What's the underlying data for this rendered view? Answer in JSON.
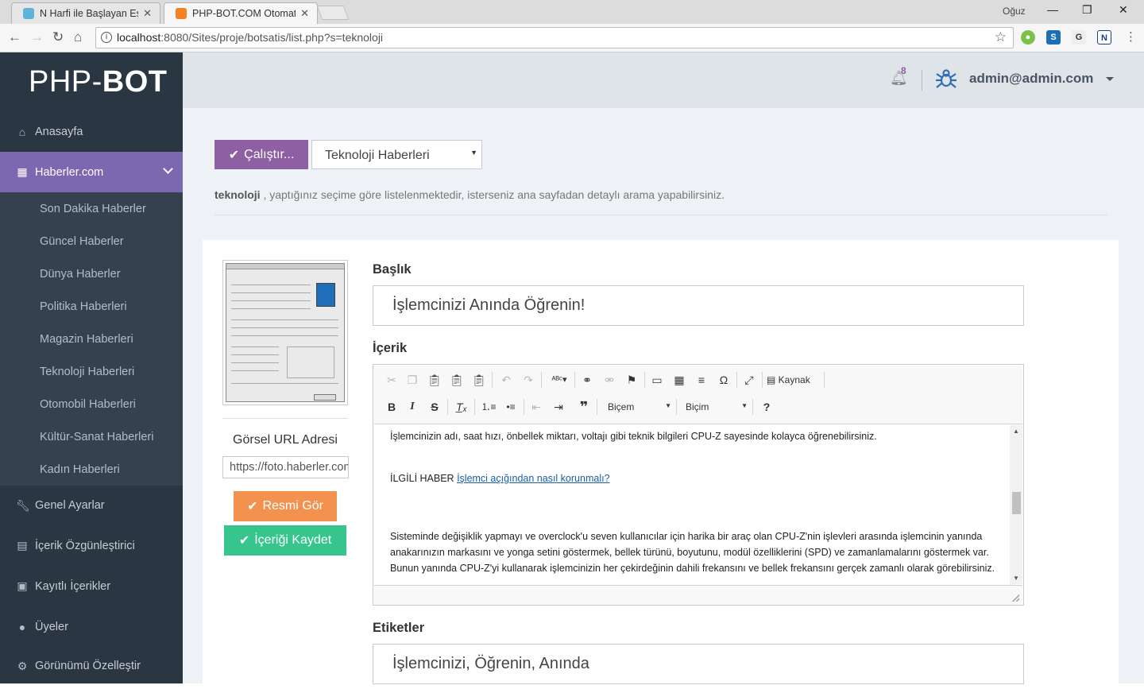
{
  "browser": {
    "tabs": [
      {
        "title": "N Harfi ile Başlayan Eş Ar",
        "active": false
      },
      {
        "title": "PHP-BOT.COM Otomatik",
        "active": true
      }
    ],
    "profile": "Oğuz",
    "url_host": "localhost",
    "url_rest": ":8080/Sites/proje/botsatis/list.php?s=teknoloji"
  },
  "sidebar": {
    "logo_light": "PHP-",
    "logo_bold": "BOT",
    "items": [
      {
        "label": "Anasayfa",
        "icon": "home-icon"
      },
      {
        "label": "Haberler.com",
        "icon": "grid-icon",
        "active": true
      },
      {
        "label": "Genel Ayarlar",
        "icon": "wrench-icon"
      },
      {
        "label": "İçerik Özgünleştirici",
        "icon": "file-icon"
      },
      {
        "label": "Kayıtlı İçerikler",
        "icon": "save-icon"
      },
      {
        "label": "Üyeler",
        "icon": "user-icon"
      },
      {
        "label": "Görünümü Özelleştir",
        "icon": "gear-icon"
      }
    ],
    "subitems": [
      "Son Dakika Haberler",
      "Güncel Haberler",
      "Dünya Haberler",
      "Politika Haberleri",
      "Magazin Haberleri",
      "Teknoloji Haberleri",
      "Otomobil Haberleri",
      "Kültür-Sanat Haberleri",
      "Kadın Haberleri"
    ]
  },
  "header": {
    "notification_count": "8",
    "user": "admin@admin.com"
  },
  "toolbar": {
    "run_label": "Çalıştır...",
    "category_selected": "Teknoloji Haberleri"
  },
  "info": {
    "keyword": "teknoloji",
    "text": " , yaptığınız seçime göre listelenmektedir, isterseniz ana sayfadan detaylı arama yapabilirsiniz."
  },
  "image_panel": {
    "url_label": "Görsel URL Adresi",
    "url_value": "https://foto.haberler.com",
    "show_image_label": "Resmi Gör",
    "save_label": "İçeriği Kaydet"
  },
  "form": {
    "title_label": "Başlık",
    "title_value": "İşlemcinizi Anında Öğrenin!",
    "content_label": "İçerik",
    "tags_label": "Etiketler",
    "tags_value": "İşlemcinizi, Öğrenin, Anında"
  },
  "editor": {
    "source_label": "Kaynak",
    "format_label_1": "Biçem",
    "format_label_2": "Biçim",
    "para1": "İşlemcinizin adı, saat hızı, önbellek miktarı, voltajı gibi teknik bilgileri CPU-Z sayesinde kolayca öğrenebilirsiniz.",
    "related_prefix": "İLGİLİ HABER ",
    "related_link": "İşlemci açığından nasıl korunmalı?",
    "para2": "Sisteminde değişiklik yapmayı ve overclock'u seven kullanıcılar için harika bir araç olan CPU-Z'nin işlevleri arasında işlemcinin yanında anakarınızın markasını ve yonga setini göstermek, bellek türünü, boyutunu, modül özelliklerini (SPD) ve zamanlamalarını göstermek var. Bunun yanında CPU-Z'yi kullanarak işlemcinizin her çekirdeğinin dahili frekansını ve bellek frekansını gerçek zamanlı olarak görebilirsiniz."
  },
  "colors": {
    "sidebar": "#2b3643",
    "accent": "#8e5fa2",
    "active_menu": "#7b68b1",
    "orange": "#f3924f",
    "green": "#36c68d"
  }
}
